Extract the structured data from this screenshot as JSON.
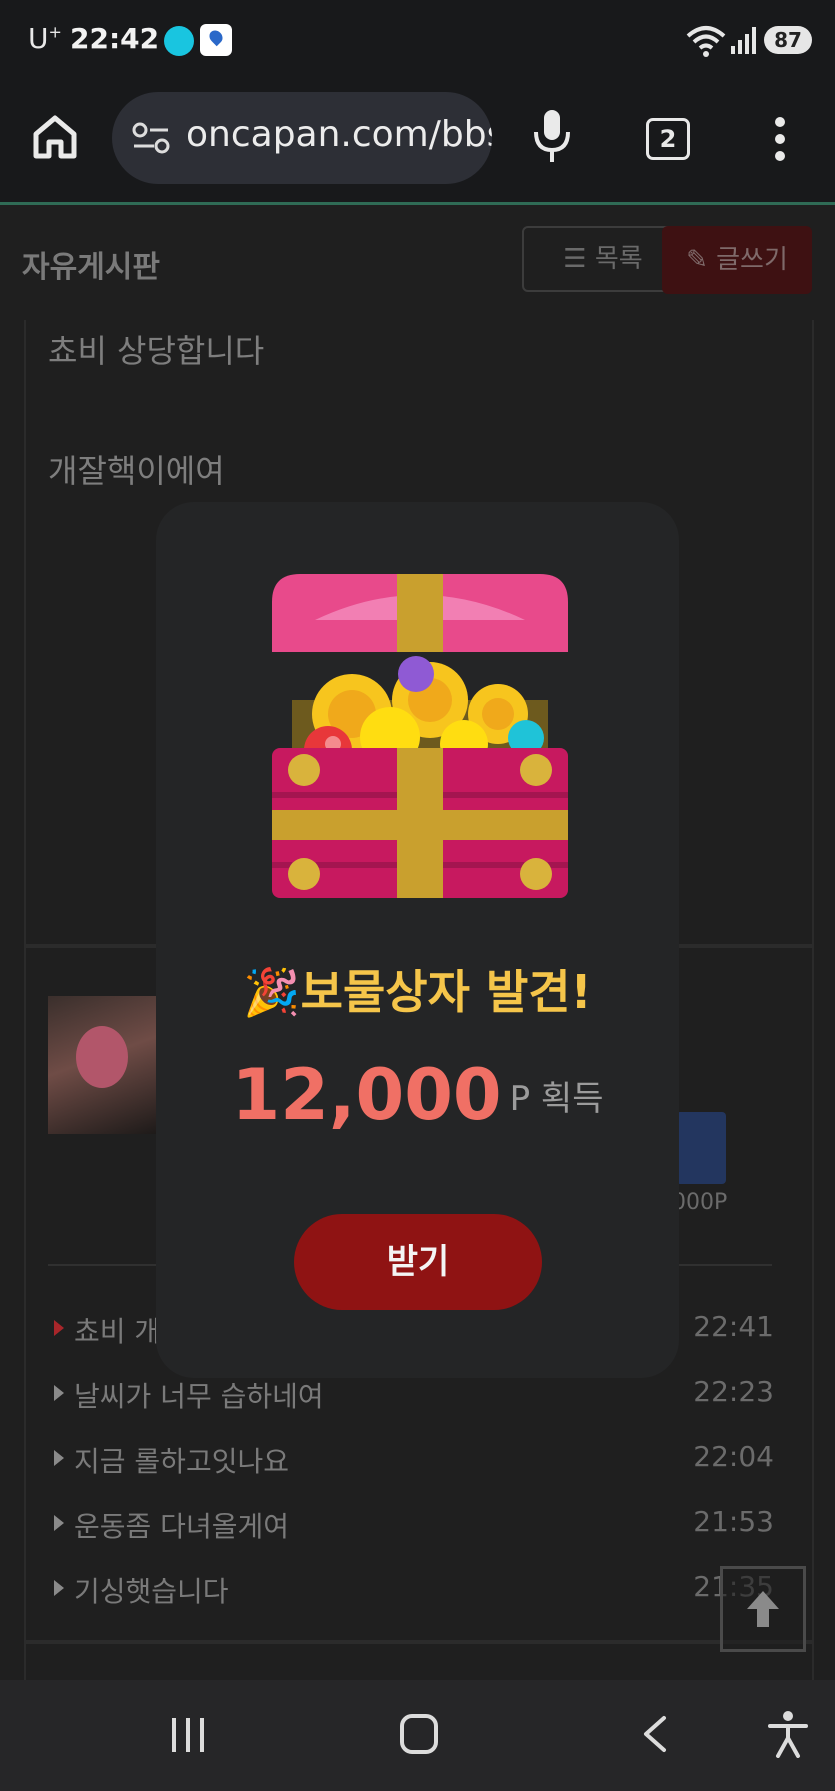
{
  "status_bar": {
    "carrier": "U",
    "carrier_sup": "+",
    "time": "22:42",
    "battery": "87",
    "icons": [
      "app-swirl-icon",
      "app-map-icon",
      "wifi-icon",
      "signal-icon",
      "battery-icon"
    ]
  },
  "browser": {
    "url": "oncapan.com/bbs",
    "tab_count": "2",
    "icons": [
      "home-icon",
      "site-settings-icon",
      "mic-icon",
      "tabs-icon",
      "more-icon"
    ]
  },
  "board": {
    "title": "자유게시판",
    "list_button": "목록",
    "write_button": "글쓰기"
  },
  "post": {
    "lines": [
      "쵸비 상당합니다",
      "개잘핵이에여"
    ],
    "point_text": "000P"
  },
  "recent_posts": [
    {
      "title": "쵸비 개",
      "time": "22:41",
      "active": true
    },
    {
      "title": "날씨가 너무 습하네여",
      "time": "22:23",
      "active": false
    },
    {
      "title": "지금 롤하고잇나요",
      "time": "22:04",
      "active": false
    },
    {
      "title": "운동좀 다녀올게여",
      "time": "21:53",
      "active": false
    },
    {
      "title": "기싱햇습니다",
      "time": "21:35",
      "active": false
    }
  ],
  "modal": {
    "title": "🎉보물상자 발견!",
    "amount": "12,000",
    "unit": "P 획득",
    "button": "받기",
    "icon": "treasure-chest-icon"
  },
  "colors": {
    "accent_red": "#8f1313",
    "gold": "#f5c54a",
    "amount": "#f07065",
    "background": "#1f1f1f"
  }
}
